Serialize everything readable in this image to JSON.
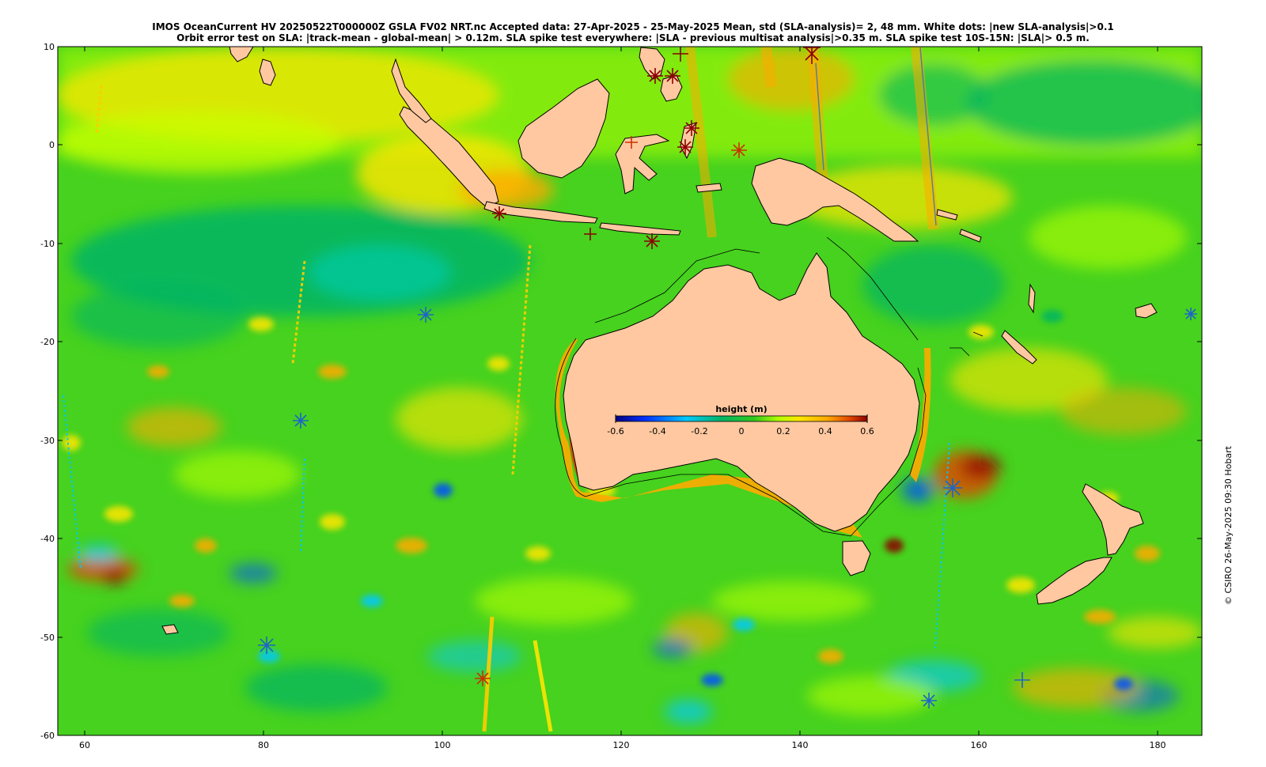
{
  "title": {
    "line1": "IMOS OceanCurrent HV 20250522T000000Z GSLA FV02 NRT.nc  Accepted data: 27-Apr-2025 - 25-May-2025 Mean, std (SLA-analysis)= 2, 48 mm. White dots: |new SLA-analysis|>0.1",
    "line2": "Orbit error test on SLA: |track-mean  - global-mean| > 0.12m.  SLA spike test everywhere: |SLA - previous multisat analysis|>0.35 m. SLA spike test 10S-15N: |SLA|> 0.5 m."
  },
  "credit": "© CSIRO 26-May-2025 09:30 Hobart",
  "axes": {
    "x_ticks": [
      "60",
      "80",
      "100",
      "120",
      "140",
      "160",
      "180"
    ],
    "y_ticks": [
      "10",
      "0",
      "-10",
      "-20",
      "-30",
      "-40",
      "-50",
      "-60"
    ],
    "xlim": [
      57,
      185
    ],
    "ylim": [
      -60,
      10
    ]
  },
  "colorbar": {
    "title": "height (m)",
    "ticks": [
      "-0.6",
      "-0.4",
      "-0.2",
      "0",
      "0.2",
      "0.4",
      "0.6"
    ],
    "range": [
      -0.6,
      0.6
    ]
  },
  "colors": {
    "land": "#ffc8a0",
    "ocean_base": "#46d21e",
    "colormap": [
      "#000080",
      "#0050ff",
      "#00c8ff",
      "#00b464",
      "#32c81e",
      "#b4ff00",
      "#ffe600",
      "#ffaa00",
      "#e14600",
      "#8b0000"
    ]
  },
  "landmasses": [
    "Australia",
    "New Guinea",
    "Borneo",
    "Sumatra",
    "Java",
    "Sulawesi",
    "New Zealand North Island",
    "New Zealand South Island",
    "Sri Lanka",
    "Tasmania",
    "Philippines",
    "Malay Peninsula",
    "New Caledonia",
    "Solomon Islands"
  ]
}
